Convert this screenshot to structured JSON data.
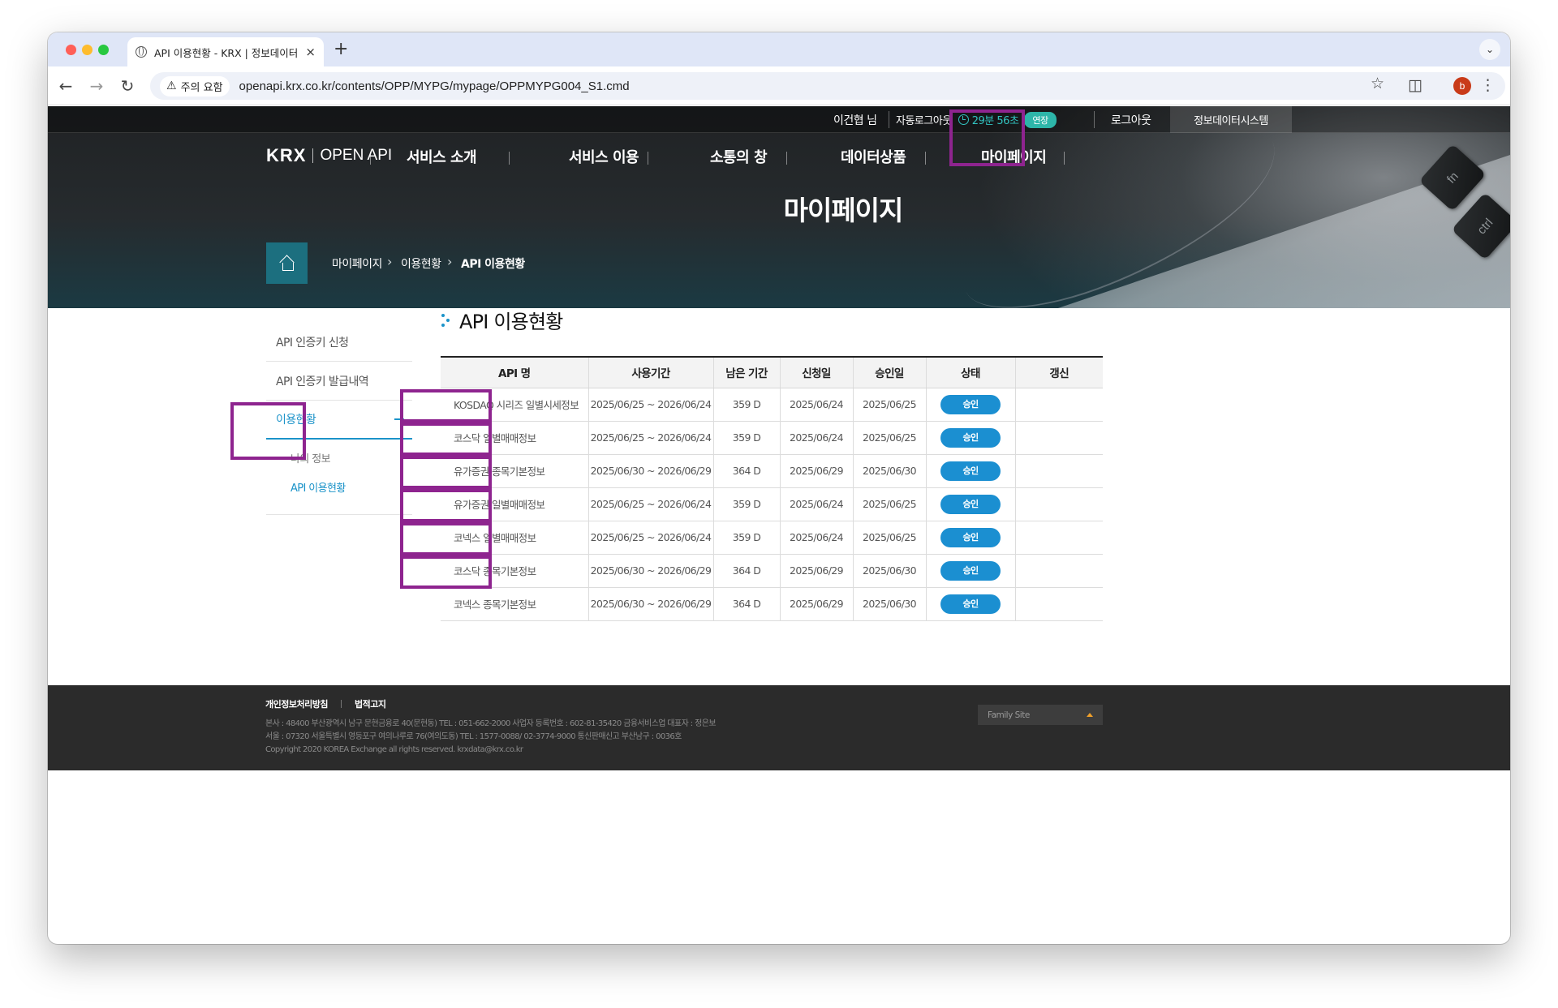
{
  "browser": {
    "tab_title": "API 이용현황 - KRX | 정보데이터",
    "tab_close": "×",
    "new_tab": "+",
    "security_label": "주의 요함",
    "url": "openapi.krx.co.kr/contents/OPP/MYPG/mypage/OPPMYPG004_S1.cmd",
    "profile_initial": "b"
  },
  "utility": {
    "user": "이건협 님",
    "auto_logout": "자동로그아웃",
    "timer": "29분 56초",
    "extend": "연장",
    "logout": "로그아웃",
    "system": "정보데이터시스템"
  },
  "brand": {
    "krx": "KRX",
    "openapi": "OPEN API"
  },
  "gnb": [
    "서비스 소개",
    "서비스 이용",
    "소통의 창",
    "데이터상품",
    "마이페이지"
  ],
  "hero_title": "마이페이지",
  "breadcrumb": [
    "마이페이지",
    "이용현황",
    "API 이용현황"
  ],
  "lnb": {
    "items": [
      "API 인증키 신청",
      "API 인증키 발급내역",
      "이용현황"
    ],
    "sub_items": [
      "나의 정보",
      "API 이용현황"
    ]
  },
  "page_title": "API 이용현황",
  "table": {
    "headers": [
      "API 명",
      "사용기간",
      "남은 기간",
      "신청일",
      "승인일",
      "상태",
      "갱신"
    ],
    "rows": [
      {
        "name": "KOSDAQ 시리즈 일별시세정보",
        "period": "2025/06/25 ~ 2026/06/24",
        "remaining": "359 D",
        "applied": "2025/06/24",
        "approved": "2025/06/25",
        "status": "승인",
        "renew": ""
      },
      {
        "name": "코스닥 일별매매정보",
        "period": "2025/06/25 ~ 2026/06/24",
        "remaining": "359 D",
        "applied": "2025/06/24",
        "approved": "2025/06/25",
        "status": "승인",
        "renew": ""
      },
      {
        "name": "유가증권 종목기본정보",
        "period": "2025/06/30 ~ 2026/06/29",
        "remaining": "364 D",
        "applied": "2025/06/29",
        "approved": "2025/06/30",
        "status": "승인",
        "renew": ""
      },
      {
        "name": "유가증권 일별매매정보",
        "period": "2025/06/25 ~ 2026/06/24",
        "remaining": "359 D",
        "applied": "2025/06/24",
        "approved": "2025/06/25",
        "status": "승인",
        "renew": ""
      },
      {
        "name": "코넥스 일별매매정보",
        "period": "2025/06/25 ~ 2026/06/24",
        "remaining": "359 D",
        "applied": "2025/06/24",
        "approved": "2025/06/25",
        "status": "승인",
        "renew": ""
      },
      {
        "name": "코스닥 종목기본정보",
        "period": "2025/06/30 ~ 2026/06/29",
        "remaining": "364 D",
        "applied": "2025/06/29",
        "approved": "2025/06/30",
        "status": "승인",
        "renew": ""
      },
      {
        "name": "코넥스 종목기본정보",
        "period": "2025/06/30 ~ 2026/06/29",
        "remaining": "364 D",
        "applied": "2025/06/29",
        "approved": "2025/06/30",
        "status": "승인",
        "renew": ""
      }
    ]
  },
  "footer": {
    "links": [
      "개인정보처리방침",
      "법적고지"
    ],
    "info": [
      "본사 : 48400 부산광역시 남구 문현금융로 40(문현동) TEL : 051-662-2000 사업자 등록번호 : 602-81-35420 금융서비스업 대표자 : 정은보",
      "서울 : 07320 서울특별시 영등포구 여의나루로 76(여의도동) TEL : 1577-0088/ 02-3774-9000 통신판매신고 부산남구 : 0036호",
      "Copyright 2020 KOREA Exchange all rights reserved. krxdata@krx.co.kr"
    ],
    "family_site": "Family Site"
  },
  "colors": {
    "accent": "#1b93c9",
    "highlight": "#8e248f",
    "hero_dark": "#202224",
    "teal": "#2db6a9"
  }
}
